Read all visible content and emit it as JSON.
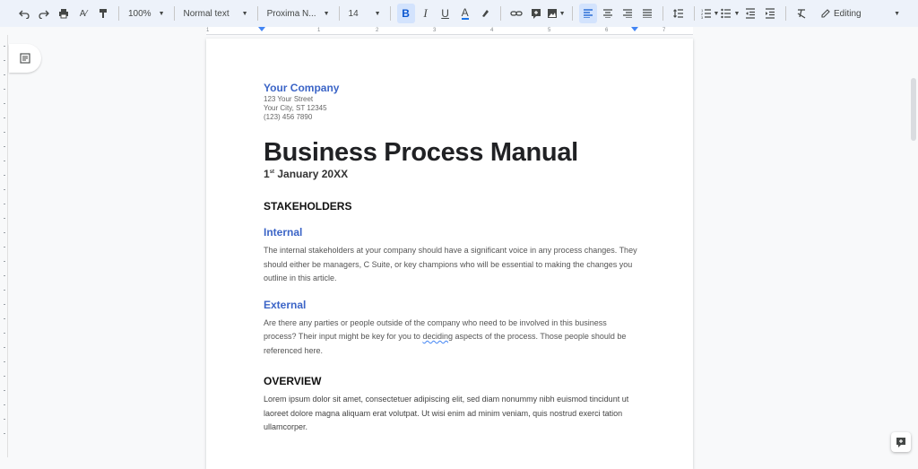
{
  "toolbar": {
    "zoom": "100%",
    "style": "Normal text",
    "font": "Proxima N...",
    "font_size": "14",
    "mode": "Editing",
    "icons": [
      "undo-icon",
      "redo-icon",
      "print-icon",
      "spellcheck-icon",
      "paint-format-icon",
      "bold-icon",
      "italic-icon",
      "underline-icon",
      "text-color-icon",
      "highlight-icon",
      "link-icon",
      "comment-icon",
      "image-icon",
      "align-left-icon",
      "align-center-icon",
      "align-right-icon",
      "justify-icon",
      "line-spacing-icon",
      "numbered-list-icon",
      "bulleted-list-icon",
      "decrease-indent-icon",
      "increase-indent-icon",
      "clear-formatting-icon",
      "pencil-icon"
    ],
    "accent": "#0b57d0"
  },
  "ruler": {
    "numbers": [
      "1",
      "1",
      "2",
      "3",
      "4",
      "5",
      "6",
      "7"
    ]
  },
  "document": {
    "company": "Your Company",
    "address": [
      "123 Your Street",
      "Your City, ST 12345",
      "(123) 456 7890"
    ],
    "title": "Business Process Manual",
    "date_day": "1",
    "date_suffix": "st",
    "date_rest": " January 20XX",
    "stakeholders_heading": "STAKEHOLDERS",
    "internal_heading": "Internal",
    "internal_text": "The internal stakeholders at your company should have a significant voice in any process changes. They should either be managers, C Suite, or key champions who will be essential to making the changes you outline in this article.",
    "external_heading": "External",
    "external_text_1": "Are there any parties or people outside of the company who need to be involved in this business process? Their input might be key for you to ",
    "external_text_word": "deciding",
    "external_text_2": " aspects of the process. Those people should be referenced here.",
    "overview_heading": "OVERVIEW",
    "overview_text": "Lorem ipsum dolor sit amet, consectetuer adipiscing elit, sed diam nonummy nibh euismod tincidunt ut laoreet dolore magna aliquam erat volutpat. Ut wisi enim ad minim veniam, quis nostrud exerci tation ullamcorper.",
    "accent_color": "#3c65c7"
  }
}
